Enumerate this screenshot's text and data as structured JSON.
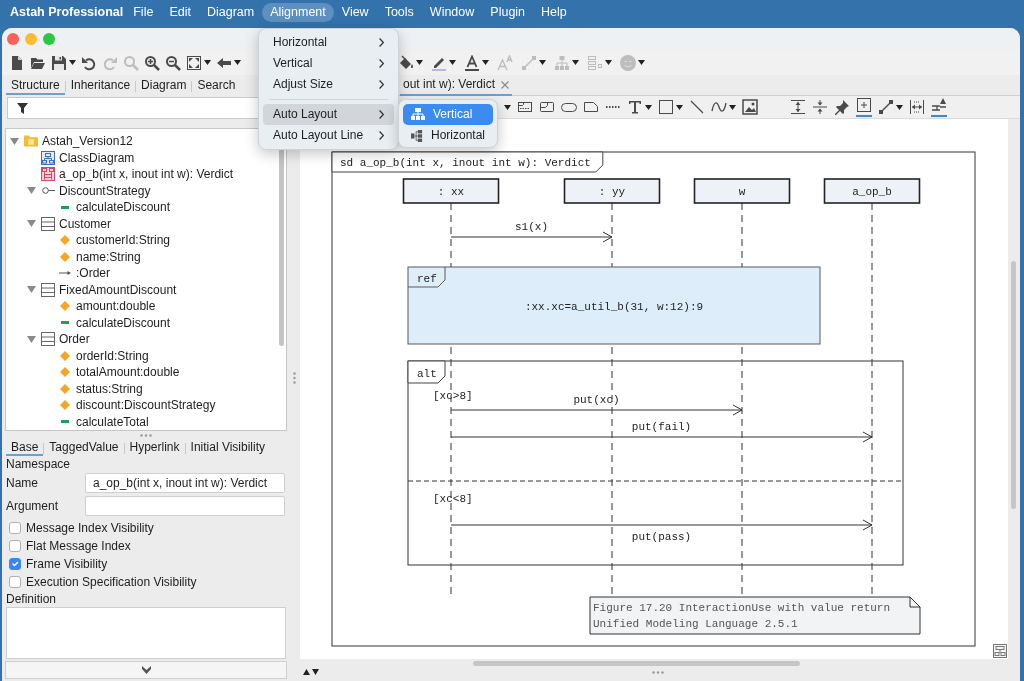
{
  "menu_bar": {
    "app_name": "Astah Professional",
    "items": [
      {
        "label": "File",
        "selected": false
      },
      {
        "label": "Edit",
        "selected": false
      },
      {
        "label": "Diagram",
        "selected": false
      },
      {
        "label": "Alignment",
        "selected": true
      },
      {
        "label": "View",
        "selected": false
      },
      {
        "label": "Tools",
        "selected": false
      },
      {
        "label": "Window",
        "selected": false
      },
      {
        "label": "Plugin",
        "selected": false
      },
      {
        "label": "Help",
        "selected": false
      }
    ]
  },
  "toolbar": {
    "groups": [
      {
        "items": [
          {
            "kind": "new",
            "disabled": false,
            "dropdown": false
          },
          {
            "kind": "open",
            "disabled": false,
            "dropdown": false
          },
          {
            "kind": "save",
            "disabled": false,
            "dropdown": true
          },
          {
            "kind": "undo",
            "disabled": false,
            "dropdown": false
          },
          {
            "kind": "redo",
            "disabled": true,
            "dropdown": false
          },
          {
            "kind": "zoom",
            "disabled": true,
            "dropdown": false
          },
          {
            "kind": "zoomin",
            "disabled": false,
            "dropdown": false
          },
          {
            "kind": "zoomout",
            "disabled": false,
            "dropdown": false
          },
          {
            "kind": "fit",
            "disabled": false,
            "dropdown": true
          },
          {
            "kind": "back",
            "disabled": false,
            "dropdown": true
          }
        ]
      },
      {
        "items": [
          {
            "kind": "fill",
            "disabled": false,
            "dropdown": true
          },
          {
            "kind": "pen",
            "disabled": false,
            "dropdown": true
          },
          {
            "kind": "fontcolor",
            "disabled": false,
            "dropdown": true
          },
          {
            "kind": "fontsize",
            "disabled": true,
            "dropdown": false
          },
          {
            "kind": "connector",
            "disabled": true,
            "dropdown": true
          },
          {
            "kind": "tree",
            "disabled": true,
            "dropdown": true
          },
          {
            "kind": "layout",
            "disabled": true,
            "dropdown": true
          },
          {
            "kind": "emoji",
            "disabled": true,
            "dropdown": true
          }
        ]
      }
    ]
  },
  "navigator": {
    "tabs": [
      {
        "label": "Structure",
        "selected": true
      },
      {
        "label": "Inheritance",
        "selected": false
      },
      {
        "label": "Diagram",
        "selected": false
      },
      {
        "label": "Search",
        "selected": false
      }
    ],
    "tree": [
      {
        "kind": "package",
        "label": "Astah_Version12",
        "expanded": true,
        "children": [
          {
            "kind": "classdiagram",
            "label": "ClassDiagram"
          },
          {
            "kind": "sequence",
            "label": "a_op_b(int x, inout int w): Verdict"
          },
          {
            "kind": "interface",
            "label": "DiscountStrategy",
            "expanded": true,
            "children": [
              {
                "kind": "operation",
                "label": "calculateDiscount"
              }
            ]
          },
          {
            "kind": "class",
            "label": "Customer",
            "expanded": true,
            "children": [
              {
                "kind": "attribute",
                "label": "customerId:String"
              },
              {
                "kind": "attribute",
                "label": "name:String"
              },
              {
                "kind": "association",
                "label": ":Order"
              }
            ]
          },
          {
            "kind": "class",
            "label": "FixedAmountDiscount",
            "expanded": true,
            "children": [
              {
                "kind": "attribute",
                "label": "amount:double"
              },
              {
                "kind": "operation",
                "label": "calculateDiscount"
              }
            ]
          },
          {
            "kind": "class",
            "label": "Order",
            "expanded": true,
            "children": [
              {
                "kind": "attribute",
                "label": "orderId:String"
              },
              {
                "kind": "attribute",
                "label": "totalAmount:double"
              },
              {
                "kind": "attribute",
                "label": "status:String"
              },
              {
                "kind": "attribute",
                "label": "discount:DiscountStrategy"
              },
              {
                "kind": "operation",
                "label": "calculateTotal"
              }
            ]
          }
        ]
      }
    ]
  },
  "properties": {
    "tabs": [
      {
        "label": "Base",
        "selected": true
      },
      {
        "label": "TaggedValue",
        "selected": false
      },
      {
        "label": "Hyperlink",
        "selected": false
      },
      {
        "label": "Initial Visibility",
        "selected": false
      }
    ],
    "section": "Namespace",
    "fields": [
      {
        "label": "Name",
        "value": "a_op_b(int x, inout int w): Verdict"
      },
      {
        "label": "Argument"
      }
    ],
    "options": [
      {
        "label": "Message Index Visibility",
        "checked": false
      },
      {
        "label": "Flat Message Index",
        "checked": false
      },
      {
        "label": "Frame Visibility",
        "checked": true
      },
      {
        "label": "Execution Specification Visibility",
        "checked": false
      }
    ],
    "definition_label": "Definition"
  },
  "editor": {
    "tabs": [
      {
        "label": "out int w): Verdict",
        "selected": true
      }
    ],
    "toolbar": {
      "groups": [
        {
          "items": [
            {
              "kind": "fragment",
              "dropdown": false,
              "on": false
            },
            {
              "kind": "state",
              "dropdown": false,
              "on": false
            },
            {
              "kind": "rounded",
              "dropdown": false,
              "on": false
            },
            {
              "kind": "note",
              "dropdown": false,
              "on": false
            },
            {
              "kind": "dots",
              "dropdown": false,
              "on": false
            },
            {
              "kind": "text",
              "dropdown": true,
              "on": false
            },
            {
              "kind": "rect",
              "dropdown": true,
              "on": false
            },
            {
              "kind": "line",
              "dropdown": false,
              "on": false
            },
            {
              "kind": "curve",
              "dropdown": true,
              "on": false
            },
            {
              "kind": "image",
              "dropdown": false,
              "on": false
            }
          ]
        },
        {
          "items": [
            {
              "kind": "expand",
              "dropdown": false,
              "on": false
            },
            {
              "kind": "compress",
              "dropdown": false,
              "on": false
            },
            {
              "kind": "pin",
              "dropdown": false,
              "on": false
            },
            {
              "kind": "insertbox",
              "dropdown": false,
              "on": true
            },
            {
              "kind": "link",
              "dropdown": true,
              "on": false
            },
            {
              "kind": "ruler",
              "dropdown": false,
              "on": false
            },
            {
              "kind": "alignstack",
              "dropdown": false,
              "on": true
            }
          ]
        }
      ]
    },
    "diagram": {
      "frame_label": "sd a_op_b(int x, inout int w): Verdict",
      "lifelines": [
        {
          "name": ": xx"
        },
        {
          "name": ": yy"
        },
        {
          "name": "w"
        },
        {
          "name": "a_op_b"
        }
      ],
      "elements": [
        {
          "kind": "message",
          "label": "s1(x)"
        },
        {
          "kind": "ref",
          "tag": "ref",
          "text": ":xx.xc=a_util_b(31, w:12):9"
        },
        {
          "kind": "alt",
          "tag": "alt",
          "operands": [
            {
              "guard": "[xc>8]",
              "messages": [
                {
                  "label": "put(xc)"
                },
                {
                  "label": "put(fail)"
                }
              ]
            },
            {
              "guard": "[xc<8]",
              "messages": [
                {
                  "label": "put(pass)"
                }
              ]
            }
          ]
        }
      ],
      "note": {
        "lines": [
          "Figure 17.20 InteractionUse with value return",
          "Unified Modeling Language 2.5.1"
        ]
      }
    }
  },
  "alignment_menu": {
    "items": [
      {
        "kind": "item",
        "label": "Horizontal",
        "submenu": true,
        "selected": false
      },
      {
        "kind": "item",
        "label": "Vertical",
        "submenu": true,
        "selected": false
      },
      {
        "kind": "item",
        "label": "Adjust Size",
        "submenu": true,
        "selected": false
      },
      {
        "kind": "separator"
      },
      {
        "kind": "item",
        "label": "Auto Layout",
        "submenu": true,
        "selected": true
      },
      {
        "kind": "item",
        "label": "Auto Layout Line",
        "submenu": true,
        "selected": false
      }
    ],
    "submenu": {
      "items": [
        {
          "kind": "vertical",
          "label": "Vertical",
          "selected": true
        },
        {
          "kind": "horizontal",
          "label": "Horizontal",
          "selected": false
        }
      ]
    }
  }
}
